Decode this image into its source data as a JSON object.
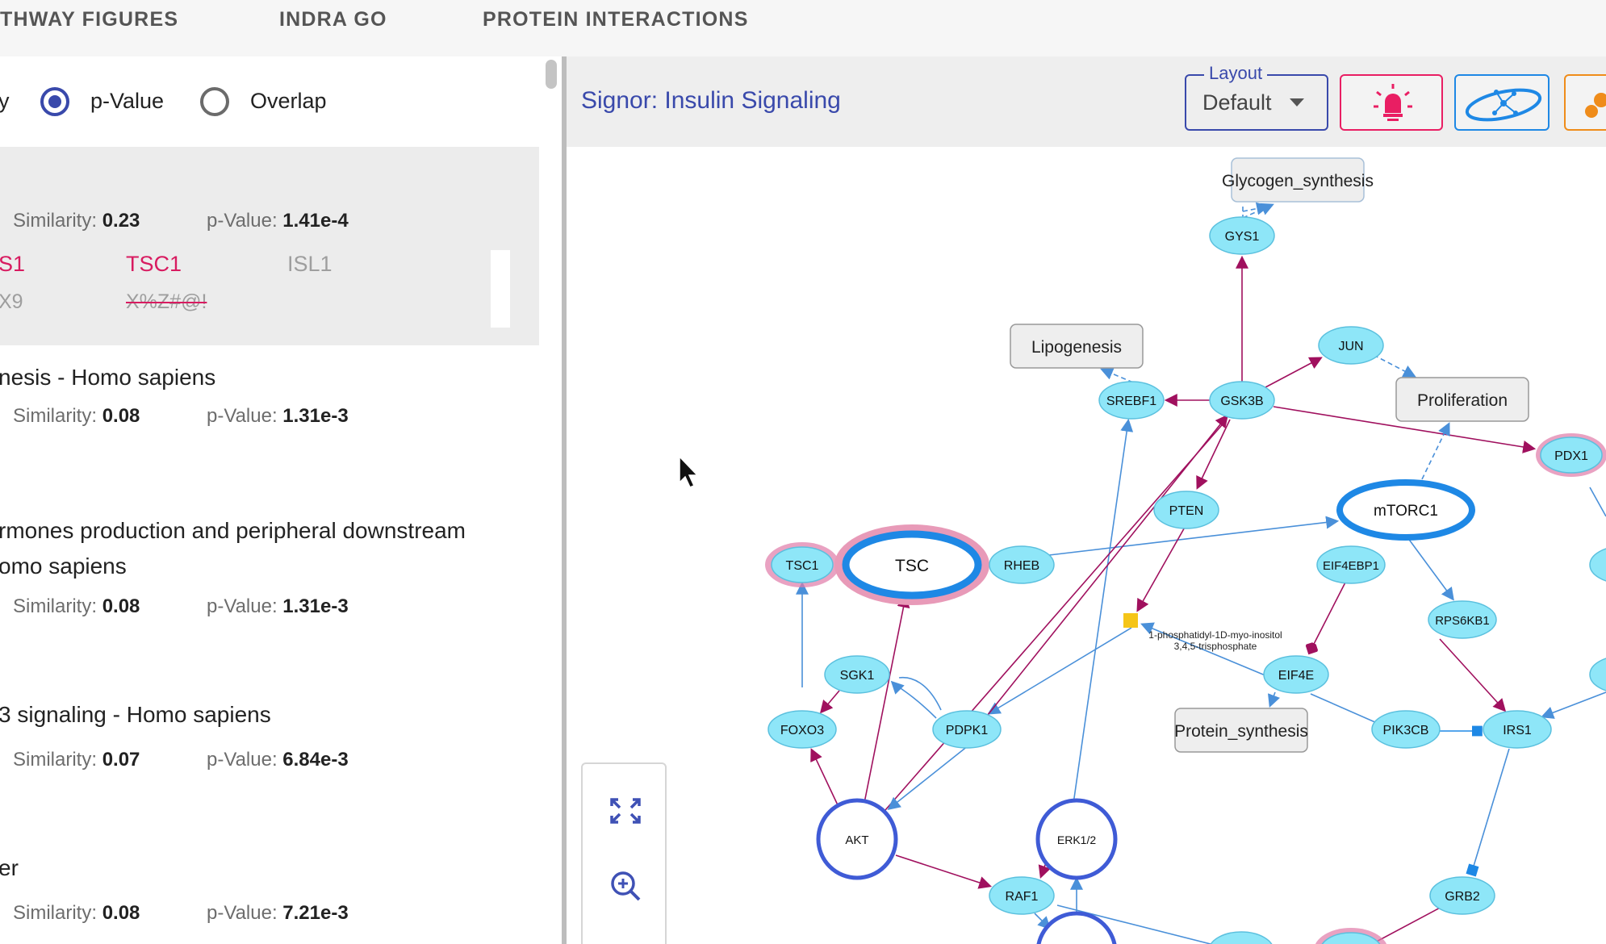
{
  "tabs": [
    {
      "label": "THWAY FIGURES"
    },
    {
      "label": "INDRA GO"
    },
    {
      "label": "PROTEIN INTERACTIONS"
    }
  ],
  "sort": {
    "partial_label": "y",
    "option1": "p-Value",
    "option2": "Overlap",
    "selected": "p-Value"
  },
  "results": [
    {
      "title": "",
      "similarity_label": "Similarity:",
      "similarity": "0.23",
      "pvalue_label": "p-Value:",
      "pvalue": "1.41e-4",
      "genes_row1": [
        "S1",
        "TSC1",
        "ISL1"
      ],
      "genes_row2": [
        "X9",
        "X%Z#@!"
      ]
    },
    {
      "title": "nesis - Homo sapiens",
      "similarity_label": "Similarity:",
      "similarity": "0.08",
      "pvalue_label": "p-Value:",
      "pvalue": "1.31e-3"
    },
    {
      "title_line1": "rmones production and peripheral downstream",
      "title_line2": "omo sapiens",
      "similarity_label": "Similarity:",
      "similarity": "0.08",
      "pvalue_label": "p-Value:",
      "pvalue": "1.31e-3"
    },
    {
      "title": "3 signaling - Homo sapiens",
      "similarity_label": "Similarity:",
      "similarity": "0.07",
      "pvalue_label": "p-Value:",
      "pvalue": "6.84e-3"
    },
    {
      "title": "er",
      "similarity_label": "Similarity:",
      "similarity": "0.08",
      "pvalue_label": "p-Value:",
      "pvalue": "7.21e-3"
    }
  ],
  "network": {
    "title": "Signor: Insulin Signaling",
    "layout_label": "Layout",
    "layout_value": "Default",
    "nodes": {
      "glycogen_synthesis": "Glycogen_synthesis",
      "gys1": "GYS1",
      "lipogenesis": "Lipogenesis",
      "jun": "JUN",
      "srebf1": "SREBF1",
      "gsk3b": "GSK3B",
      "proliferation": "Proliferation",
      "pdx1": "PDX1",
      "pten": "PTEN",
      "mtorc1": "mTORC1",
      "tsc1": "TSC1",
      "tsc": "TSC",
      "rheb": "RHEB",
      "eif4ebp1": "EIF4EBP1",
      "rps6kb1": "RPS6KB1",
      "pip3_line1": "1-phosphatidyl-1D-myo-inositol",
      "pip3_line2": "3,4,5-trisphosphate",
      "sgk1": "SGK1",
      "eif4e": "EIF4E",
      "foxo3": "FOXO3",
      "pdpk1": "PDPK1",
      "protein_synthesis": "Protein_synthesis",
      "pik3cb": "PIK3CB",
      "irs1": "IRS1",
      "akt": "AKT",
      "erk12": "ERK1/2",
      "raf1": "RAF1",
      "grb2": "GRB2"
    }
  },
  "colors": {
    "accent": "#3949ab",
    "node_fill": "#8ee6f8",
    "node_stroke": "#5bc0de",
    "highlight_pink": "#e07aa8",
    "edge_blue": "#4a90d9",
    "edge_maroon": "#a0105e",
    "red_gene": "#d81b60"
  }
}
